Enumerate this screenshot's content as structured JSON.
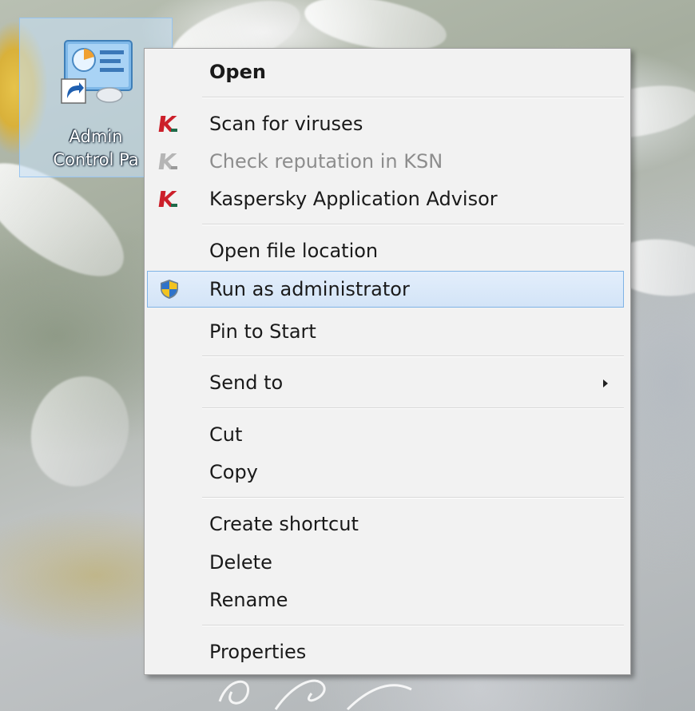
{
  "desktop": {
    "icon": {
      "name": "admin-control-panel-shortcut",
      "label_line1": "Admin",
      "label_line2": "Control Pa",
      "selected": true
    }
  },
  "context_menu": {
    "accent_color": "#cc1f2a",
    "highlight_color": "#d3e4f7",
    "items": [
      {
        "label": "Open",
        "bold": true,
        "enabled": true
      },
      {
        "label": "Scan for viruses",
        "icon": "kaspersky-icon",
        "enabled": true
      },
      {
        "label": "Check reputation in KSN",
        "icon": "kaspersky-icon-disabled",
        "enabled": false
      },
      {
        "label": "Kaspersky Application Advisor",
        "icon": "kaspersky-icon",
        "enabled": true
      },
      {
        "label": "Open file location",
        "enabled": true
      },
      {
        "label": "Run as administrator",
        "icon": "uac-shield-icon",
        "enabled": true,
        "highlighted": true
      },
      {
        "label": "Pin to Start",
        "enabled": true
      },
      {
        "label": "Send to",
        "submenu": true,
        "enabled": true
      },
      {
        "label": "Cut",
        "enabled": true
      },
      {
        "label": "Copy",
        "enabled": true
      },
      {
        "label": "Create shortcut",
        "enabled": true
      },
      {
        "label": "Delete",
        "enabled": true
      },
      {
        "label": "Rename",
        "enabled": true
      },
      {
        "label": "Properties",
        "enabled": true
      }
    ]
  }
}
